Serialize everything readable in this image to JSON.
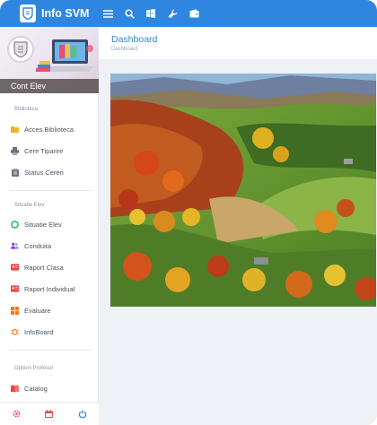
{
  "app": {
    "title": "Info SVM"
  },
  "topbar": {
    "icons": [
      "menu-icon",
      "search-icon",
      "windows-icon",
      "wrench-icon",
      "wallet-icon"
    ]
  },
  "profile": {
    "name": "Cont Elev"
  },
  "sidebar": {
    "sections": [
      {
        "label": "Biblioteca",
        "items": [
          {
            "label": "Acces Biblioteca",
            "icon": "folder-icon",
            "color": "#f0b429"
          },
          {
            "label": "Cere Tiparire",
            "icon": "printer-icon",
            "color": "#6b7280"
          },
          {
            "label": "Status Cereri",
            "icon": "clipboard-icon",
            "color": "#6b7280"
          }
        ]
      },
      {
        "label": "Situatie Elev",
        "items": [
          {
            "label": "Situatie Elev",
            "icon": "chart-icon",
            "color": "#22c55e"
          },
          {
            "label": "Conduita",
            "icon": "users-icon",
            "color": "#7c3aed"
          },
          {
            "label": "Raport Clasa",
            "icon": "id-card-icon",
            "color": "#ef4444"
          },
          {
            "label": "Raport Individual",
            "icon": "id-card-icon",
            "color": "#ef4444"
          },
          {
            "label": "Evaluare",
            "icon": "grid-icon",
            "color": "#f97316"
          },
          {
            "label": "InfoBoard",
            "icon": "bug-icon",
            "color": "#f97316"
          }
        ]
      },
      {
        "label": "Optiuni Profesor",
        "items": [
          {
            "label": "Catalog",
            "icon": "book-icon",
            "color": "#ef4444"
          }
        ]
      }
    ],
    "footer_icons": [
      "settings-icon",
      "calendar-icon",
      "power-icon"
    ]
  },
  "main": {
    "title": "Dashboard",
    "breadcrumb": "Dashboard"
  },
  "colors": {
    "accent": "#2e86e0",
    "sidebar_bg": "#ffffff",
    "main_bg": "#eef1f5"
  }
}
